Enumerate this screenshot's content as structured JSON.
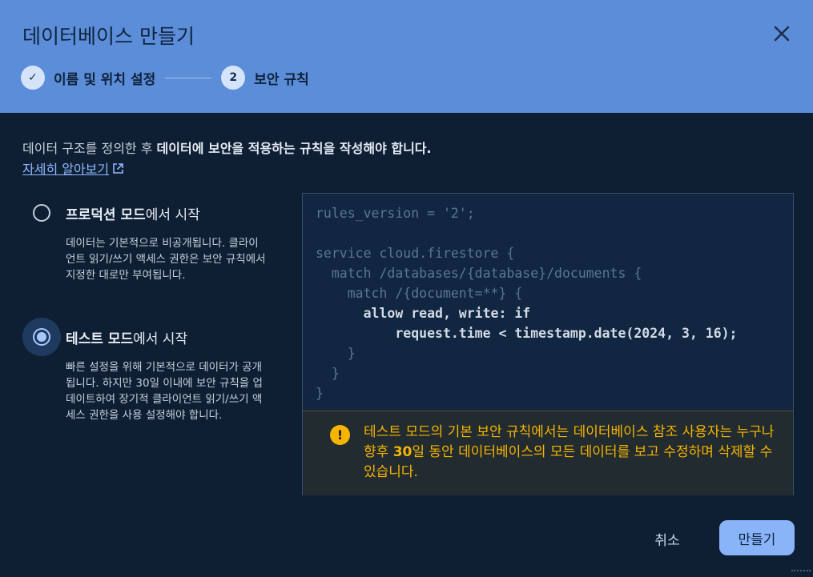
{
  "dialog": {
    "title": "데이터베이스 만들기",
    "close_label": "×"
  },
  "stepper": {
    "steps": [
      {
        "marker": "✓",
        "label": "이름 및 위치 설정"
      },
      {
        "marker": "2",
        "label": "보안 규칙"
      }
    ]
  },
  "intro": {
    "text_plain": "데이터 구조를 정의한 후 ",
    "text_bold": "데이터에 보안을 적용하는 규칙을 작성해야 합니다",
    "text_end": ".",
    "learn_more": "자세히 알아보기"
  },
  "options": [
    {
      "title_bold": "프로덕션 모드",
      "title_rest": "에서 시작",
      "description": "데이터는 기본적으로 비공개됩니다. 클라이언트 읽기/쓰기 액세스 권한은 보안 규칙에서 지정한 대로만 부여됩니다.",
      "selected": false
    },
    {
      "title_bold": "테스트 모드",
      "title_rest": "에서 시작",
      "description": "빠른 설정을 위해 기본적으로 데이터가 공개됩니다. 하지만 30일 이내에 보안 규칙을 업데이트하여 장기적 클라이언트 읽기/쓰기 액세스 권한을 사용 설정해야 합니다.",
      "selected": true
    }
  ],
  "code": {
    "lines": [
      "rules_version = '2';",
      "",
      "service cloud.firestore {",
      "  match /databases/{database}/documents {",
      "    match /{document=**} {",
      "      allow read, write: if",
      "          request.time < timestamp.date(2024, 3, 16);",
      "    }",
      "  }",
      "}"
    ]
  },
  "warning": {
    "icon": "!",
    "text_1": "테스트 모드의 기본 보안 규칙에서는 데이터베이스 참조 사용자는 누구나 향후 ",
    "text_bold": "30",
    "text_2": "일 동안 데이터베이스의 모든 데이터를 보고 수정하며 삭제할 수 있습니다."
  },
  "actions": {
    "cancel": "취소",
    "create": "만들기"
  },
  "colors": {
    "header_bg": "#5b8dd9",
    "body_bg": "#0f1f33",
    "accent": "#8ab4f8",
    "warning": "#f5b400"
  }
}
